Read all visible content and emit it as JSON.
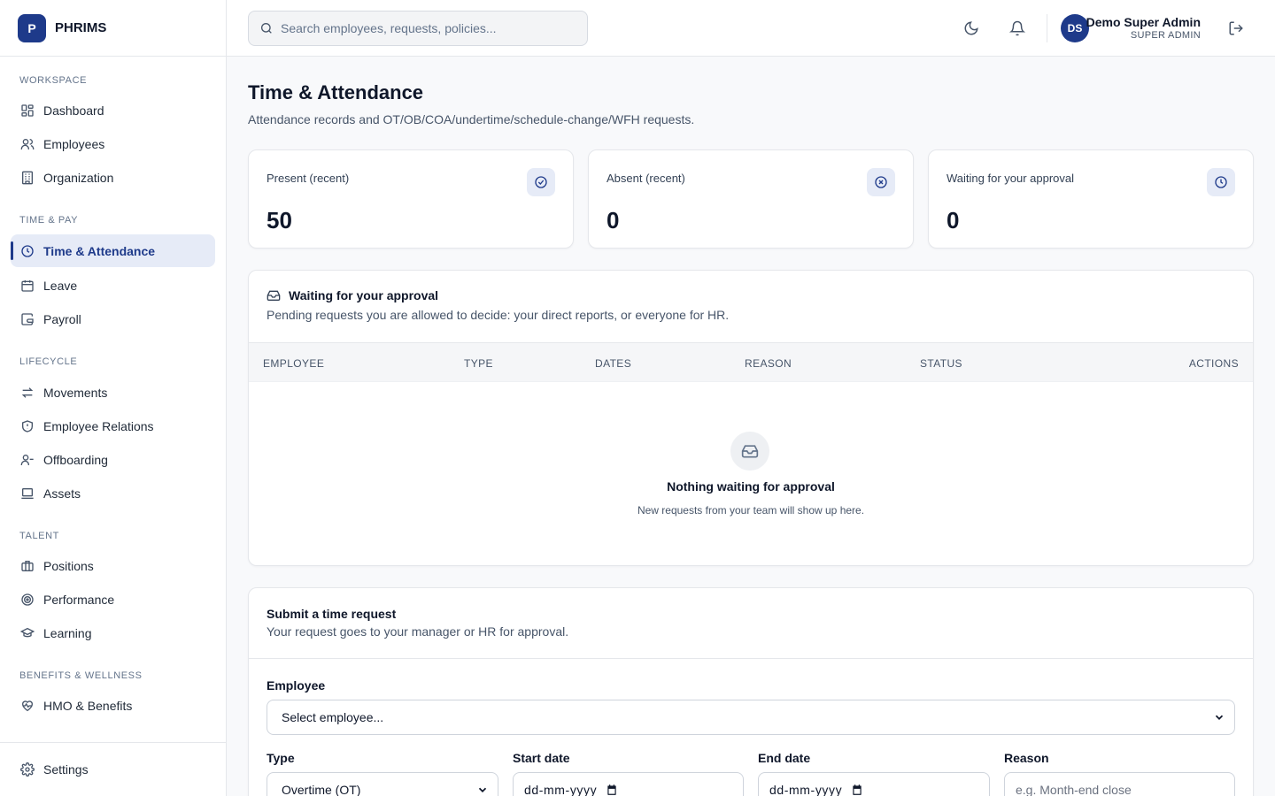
{
  "brand": {
    "logo_letter": "P",
    "name": "PHRIMS"
  },
  "sidebar": {
    "sections": [
      {
        "title": "WORKSPACE",
        "items": [
          {
            "label": "Dashboard",
            "icon": "dashboard-icon"
          },
          {
            "label": "Employees",
            "icon": "users-icon"
          },
          {
            "label": "Organization",
            "icon": "building-icon"
          }
        ]
      },
      {
        "title": "TIME & PAY",
        "items": [
          {
            "label": "Time & Attendance",
            "icon": "clock-icon",
            "active": true
          },
          {
            "label": "Leave",
            "icon": "calendar-icon"
          },
          {
            "label": "Payroll",
            "icon": "wallet-icon"
          }
        ]
      },
      {
        "title": "LIFECYCLE",
        "items": [
          {
            "label": "Movements",
            "icon": "arrows-icon"
          },
          {
            "label": "Employee Relations",
            "icon": "shield-icon"
          },
          {
            "label": "Offboarding",
            "icon": "user-minus-icon"
          },
          {
            "label": "Assets",
            "icon": "laptop-icon"
          }
        ]
      },
      {
        "title": "TALENT",
        "items": [
          {
            "label": "Positions",
            "icon": "briefcase-icon"
          },
          {
            "label": "Performance",
            "icon": "target-icon"
          },
          {
            "label": "Learning",
            "icon": "graduation-cap-icon"
          }
        ]
      },
      {
        "title": "BENEFITS & WELLNESS",
        "items": [
          {
            "label": "HMO & Benefits",
            "icon": "heart-pulse-icon"
          }
        ]
      }
    ],
    "footer": {
      "label": "Settings",
      "icon": "gear-icon"
    }
  },
  "topbar": {
    "search_placeholder": "Search employees, requests, policies...",
    "user": {
      "initials": "DS",
      "name": "Demo Super Admin",
      "role": "SUPER ADMIN"
    }
  },
  "page": {
    "title": "Time & Attendance",
    "subtitle": "Attendance records and OT/OB/COA/undertime/schedule-change/WFH requests."
  },
  "stats": [
    {
      "label": "Present (recent)",
      "value": "50",
      "icon": "check-circle-icon"
    },
    {
      "label": "Absent (recent)",
      "value": "0",
      "icon": "x-circle-icon"
    },
    {
      "label": "Waiting for your approval",
      "value": "0",
      "icon": "clock-icon"
    }
  ],
  "approval": {
    "title": "Waiting for your approval",
    "description": "Pending requests you are allowed to decide: your direct reports, or everyone for HR.",
    "columns": [
      "EMPLOYEE",
      "TYPE",
      "DATES",
      "REASON",
      "STATUS",
      "ACTIONS"
    ],
    "empty_title": "Nothing waiting for approval",
    "empty_desc": "New requests from your team will show up here."
  },
  "request_form": {
    "title": "Submit a time request",
    "description": "Your request goes to your manager or HR for approval.",
    "employee_label": "Employee",
    "employee_value": "Select employee...",
    "type_label": "Type",
    "type_value": "Overtime (OT)",
    "start_label": "Start date",
    "start_value": "dd-mm-yyyy",
    "end_label": "End date",
    "end_value": "dd-mm-yyyy",
    "reason_label": "Reason",
    "reason_placeholder": "e.g. Month-end close"
  },
  "colors": {
    "primary": "#1e3a8a",
    "accent_bg": "#e6ebf7",
    "border": "#e5e7eb"
  }
}
